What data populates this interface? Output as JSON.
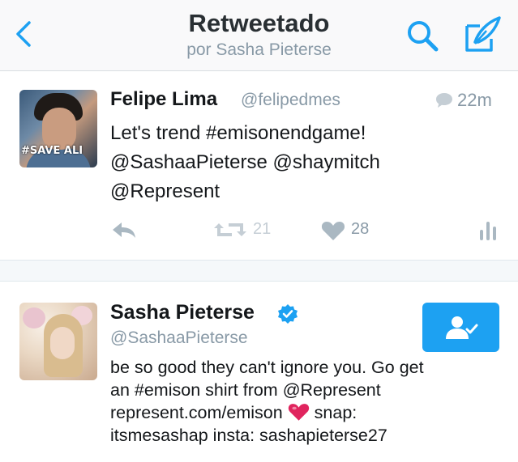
{
  "header": {
    "title": "Retweetado",
    "subtitle": "por Sasha Pieterse"
  },
  "tweet": {
    "author_name": "Felipe Lima",
    "author_handle": "@felipedmes",
    "avatar_overlay_text": "#SAVE ALI",
    "time": "22m",
    "text_lines": [
      "Let's trend #emisonendgame!",
      "@SashaaPieterse @shaymitch",
      "@Represent"
    ],
    "retweet_count": "21",
    "like_count": "28"
  },
  "profile": {
    "name": "Sasha Pieterse",
    "handle": "@SashaaPieterse",
    "bio_lines": [
      "be so good they can't ignore you. Go get",
      "an #emison shirt from @Represent",
      "represent.com/emison",
      "snap:",
      "itsmesashap insta: sashapieterse27"
    ]
  },
  "colors": {
    "accent": "#1da1f2",
    "text": "#14171a",
    "muted": "#8899a6",
    "heart": "#e0245e"
  },
  "icons": {
    "back": "chevron-left-icon",
    "search": "search-icon",
    "compose": "compose-icon",
    "reply": "reply-icon",
    "retweet": "retweet-icon",
    "like": "heart-icon",
    "stats": "stats-icon",
    "verified": "verified-badge-icon",
    "following": "following-user-icon"
  }
}
